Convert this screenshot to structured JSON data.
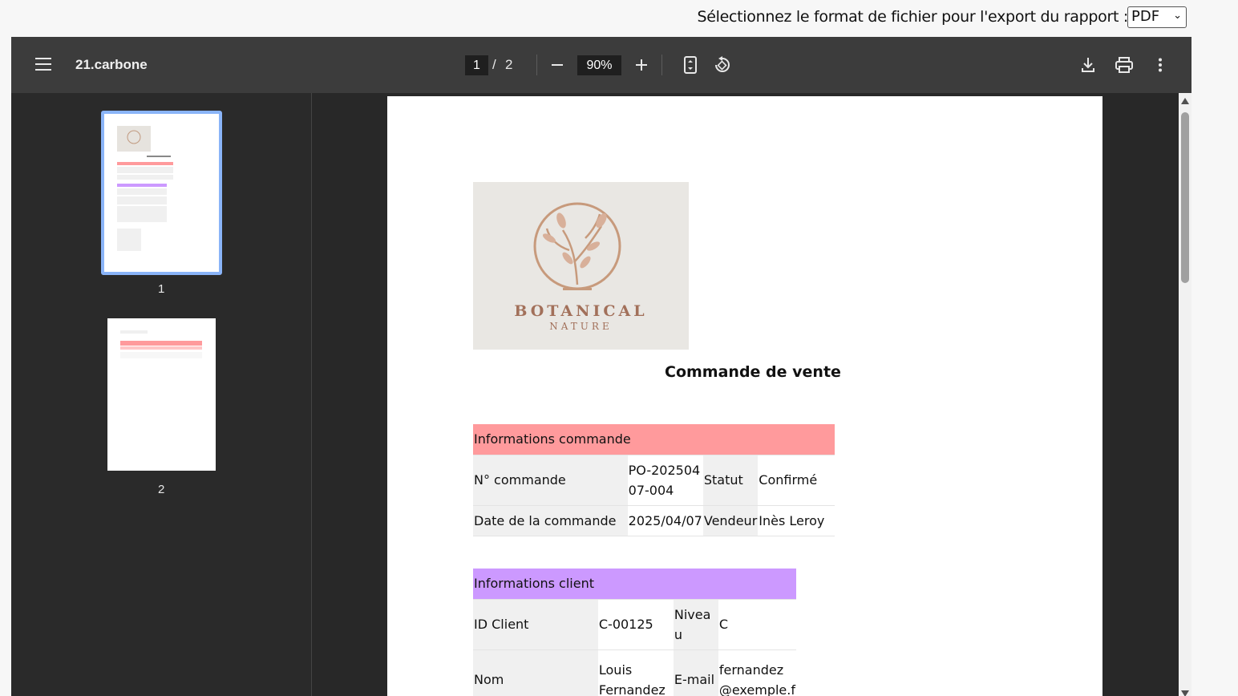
{
  "export": {
    "label": "Sélectionnez le format de fichier pour l'export du rapport :",
    "selected_format": "PDF"
  },
  "toolbar": {
    "doc_title": "21.carbone",
    "current_page": "1",
    "page_separator": "/",
    "total_pages": "2",
    "zoom": "90%"
  },
  "thumbnails": [
    {
      "label": "1"
    },
    {
      "label": "2"
    }
  ],
  "document": {
    "logo_line1": "BOTANICAL",
    "logo_line2": "NATURE",
    "heading": "Commande de vente",
    "order_section": {
      "title": "Informations commande",
      "color": "#ff9a9c",
      "rows": [
        {
          "label1": "N° commande",
          "value1": "PO-202504 07-004",
          "label2": "Statut",
          "value2": "Confirmé"
        },
        {
          "label1": "Date de la commande",
          "value1": "2025/04/07",
          "label2": "Vendeur",
          "value2": "Inès Leroy"
        }
      ]
    },
    "client_section": {
      "title": "Informations client",
      "color": "#cc99ff",
      "rows": [
        {
          "label1": "ID Client",
          "value1": "C-00125",
          "label2": "Nivea u",
          "value2": "C"
        },
        {
          "label1": "Nom",
          "value1": "Louis Fernandez",
          "label2": "E-mail",
          "value2": "fernandez @exemple.f"
        }
      ]
    }
  },
  "colors": {
    "toolbar_bg": "#3c3c3c",
    "viewer_bg": "#282828",
    "thumb_highlight": "#8ab4f8"
  }
}
